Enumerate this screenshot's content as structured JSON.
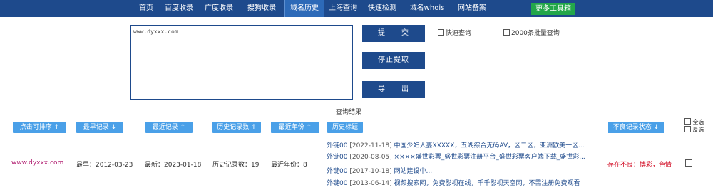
{
  "nav": {
    "items": [
      "首页",
      "百度收录",
      "广度收录",
      "搜狗收录",
      "域名历史",
      "上海查询",
      "快速检测",
      "域名whois",
      "网站备案"
    ],
    "active_index": 4,
    "tool_label": "更多工具箱"
  },
  "query": {
    "text": "www.dyxxx.com"
  },
  "buttons": {
    "submit": "提　　交",
    "stop": "停止提取",
    "export": "导　　出"
  },
  "options": {
    "fast_query": "快速查询",
    "bulk_query": "2000条批量查询"
  },
  "results": {
    "divider_label": "查询结果"
  },
  "columns": {
    "domain": "点击可排序 ↑",
    "earliest": "最早记录 ↓",
    "latest": "最近记录 ↑",
    "count": "历史记录数 ↑",
    "years": "最近年份 ↑",
    "titles": "历史标题",
    "status": "不良记录状态 ↓",
    "select_all": "全选",
    "invert": "反选"
  },
  "row": {
    "domain": "www.dyxxx.com",
    "earliest": "最早：2012-03-23",
    "latest": "最新：2023-01-18",
    "count": "历史记录数：19",
    "years": "最近年份：8",
    "history": [
      {
        "prefix": "外链00",
        "date": "[2022-11-18]",
        "title": "中国少妇人妻XXXXX，五湖综合无码AV，区二区，亚洲欧美一区..."
      },
      {
        "prefix": "外链00",
        "date": "[2020-08-05]",
        "title": "××××盛世彩票_盛世彩票注册平台_盛世彩票客户端下载_盛世彩..."
      },
      {
        "prefix": "外链00",
        "date": "[2017-10-18]",
        "title": "网站建设中..."
      },
      {
        "prefix": "外链00",
        "date": "[2013-06-14]",
        "title": "视频搜索网，免费影视在线，千千影视天空网，不需注册免费观看"
      }
    ],
    "status": "存在不良：博彩，色情"
  },
  "colors": {
    "nav_bg": "#1e4a8c",
    "header_btn": "#4aa0e8",
    "tool_btn": "#23a74a",
    "warn": "#d0021b"
  }
}
